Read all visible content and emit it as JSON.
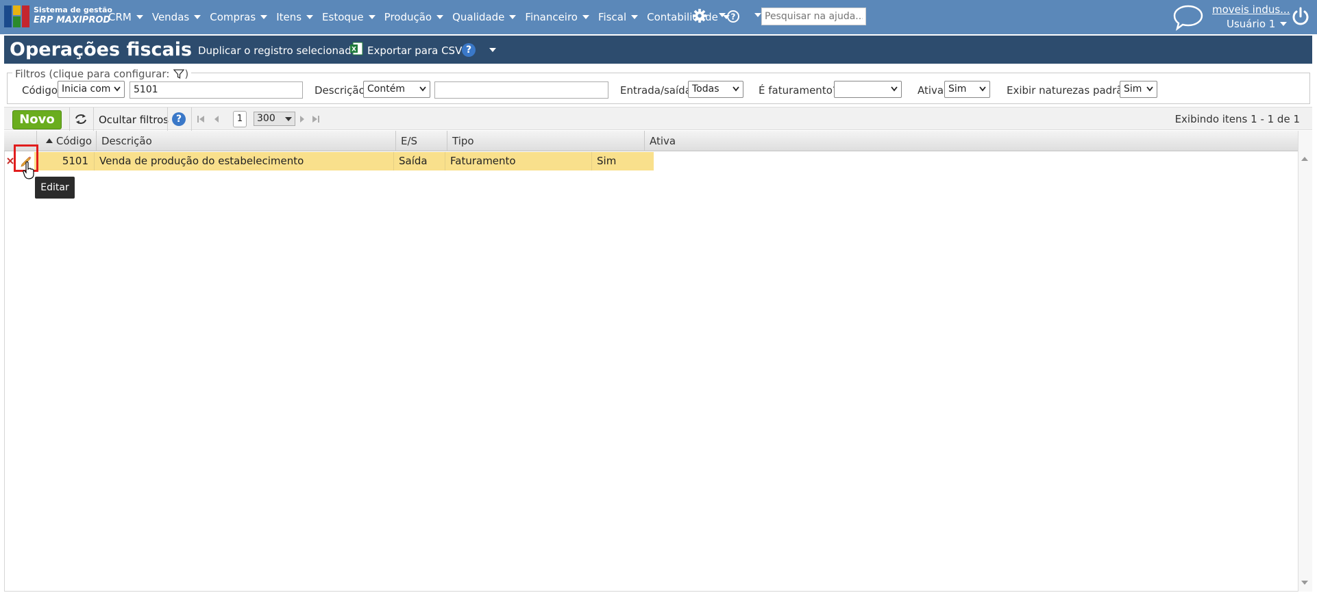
{
  "header": {
    "logo_line1": "Sistema de gestão",
    "logo_line2": "ERP MAXIPROD",
    "menu": [
      {
        "label": "CRM"
      },
      {
        "label": "Vendas"
      },
      {
        "label": "Compras"
      },
      {
        "label": "Itens"
      },
      {
        "label": "Estoque"
      },
      {
        "label": "Produção"
      },
      {
        "label": "Qualidade"
      },
      {
        "label": "Financeiro"
      },
      {
        "label": "Fiscal"
      },
      {
        "label": "Contabilidade"
      }
    ],
    "help_search_placeholder": "Pesquisar na ajuda...",
    "company": "moveis indus...",
    "user": "Usuário 1"
  },
  "title_bar": {
    "title": "Operações fiscais",
    "duplicate": "Duplicar o registro selecionado",
    "export": "Exportar para CSV",
    "help": "?"
  },
  "filters": {
    "legend": "Filtros (clique para configurar:",
    "legend_end": ")",
    "codigo_label": "Código",
    "codigo_op": "Inicia com",
    "codigo_value": "5101",
    "descricao_label": "Descrição",
    "descricao_op": "Contém",
    "descricao_value": "",
    "entrada_label": "Entrada/saída",
    "entrada_value": "Todas",
    "faturamento_label": "É faturamento?",
    "faturamento_value": "",
    "ativa_label": "Ativa",
    "ativa_value": "Sim",
    "naturezas_label": "Exibir naturezas padrão",
    "naturezas_value": "Sim"
  },
  "toolbar": {
    "novo": "Novo",
    "hide_filters": "Ocultar filtros",
    "help": "?",
    "page": "1",
    "page_size": "300",
    "status": "Exibindo itens 1 - 1 de 1"
  },
  "grid": {
    "columns": [
      "Código",
      "Descrição",
      "E/S",
      "Tipo",
      "Ativa"
    ],
    "rows": [
      {
        "codigo": "5101",
        "descricao": "Venda de produção do estabelecimento",
        "es": "Saída",
        "tipo": "Faturamento",
        "ativa": "Sim"
      }
    ]
  },
  "tooltip": "Editar",
  "colors": {
    "topbar": "#5b88b9",
    "titlebar": "#2d4c6e",
    "row_selected": "#f9e08c",
    "novo": "#6aad1e",
    "highlight": "#e11d1d"
  }
}
